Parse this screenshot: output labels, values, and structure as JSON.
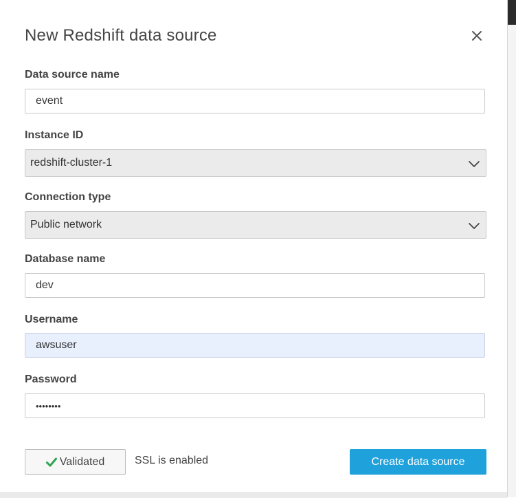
{
  "dialog": {
    "title": "New Redshift data source"
  },
  "fields": {
    "data_source_name": {
      "label": "Data source name",
      "value": "event"
    },
    "instance_id": {
      "label": "Instance ID",
      "value": "redshift-cluster-1"
    },
    "connection_type": {
      "label": "Connection type",
      "value": "Public network"
    },
    "database_name": {
      "label": "Database name",
      "value": "dev"
    },
    "username": {
      "label": "Username",
      "value": "awsuser"
    },
    "password": {
      "label": "Password",
      "value": "••••••••"
    }
  },
  "footer": {
    "validated_label": "Validated",
    "ssl_status": "SSL is enabled",
    "create_label": "Create data source"
  },
  "icons": {
    "close": "close-icon",
    "dropdown": "chevron-down-icon",
    "validated": "check-icon"
  },
  "colors": {
    "primary": "#1fa2dc",
    "check": "#2ea44f",
    "autofill_bg": "#e8f0fe"
  }
}
